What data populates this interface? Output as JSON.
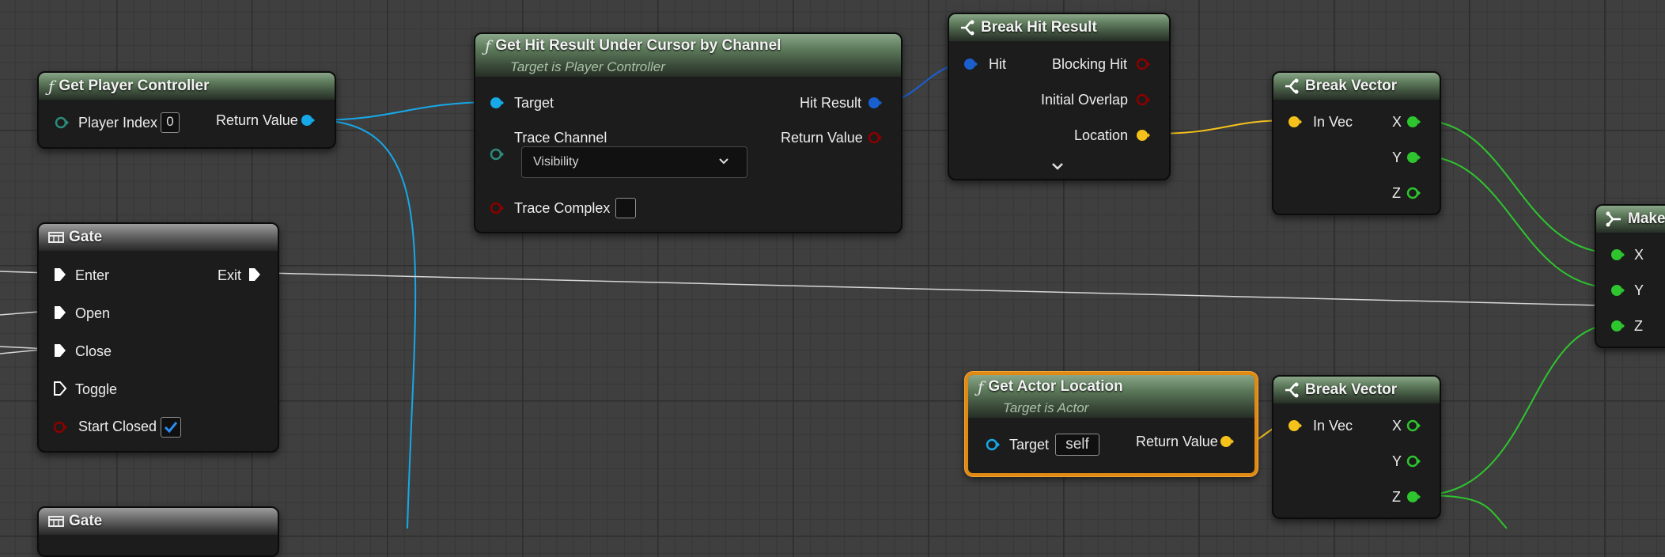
{
  "colors": {
    "exec": "#ffffff",
    "object": "#17a8e8",
    "struct_hit": "#1a5fd0",
    "vector": "#f5c21b",
    "float": "#2ec52e",
    "bool": "#8c0000",
    "trace": "#2b8a7a",
    "selected": "#e08a14"
  },
  "nodes": {
    "get_player_controller": {
      "title": "Get Player Controller",
      "player_index_label": "Player Index",
      "player_index_value": "0",
      "return_label": "Return Value"
    },
    "gate1": {
      "title": "Gate",
      "enter": "Enter",
      "exit": "Exit",
      "open": "Open",
      "close": "Close",
      "toggle": "Toggle",
      "start_closed": "Start Closed"
    },
    "gate2": {
      "title": "Gate"
    },
    "hit_under_cursor": {
      "title": "Get Hit Result Under Cursor by Channel",
      "subtitle": "Target is Player Controller",
      "target": "Target",
      "hit_result": "Hit Result",
      "trace_channel": "Trace Channel",
      "return_value": "Return Value",
      "visibility": "Visibility",
      "trace_complex": "Trace Complex"
    },
    "break_hit": {
      "title": "Break Hit Result",
      "hit": "Hit",
      "blocking_hit": "Blocking Hit",
      "initial_overlap": "Initial Overlap",
      "location": "Location"
    },
    "break_vector1": {
      "title": "Break Vector",
      "in_vec": "In Vec",
      "x": "X",
      "y": "Y",
      "z": "Z"
    },
    "get_actor_location": {
      "title": "Get Actor Location",
      "subtitle": "Target is Actor",
      "target": "Target",
      "target_value": "self",
      "return_value": "Return Value"
    },
    "break_vector2": {
      "title": "Break Vector",
      "in_vec": "In Vec",
      "x": "X",
      "y": "Y",
      "z": "Z"
    },
    "make_vector": {
      "title": "Make",
      "x": "X",
      "y": "Y",
      "z": "Z"
    }
  }
}
